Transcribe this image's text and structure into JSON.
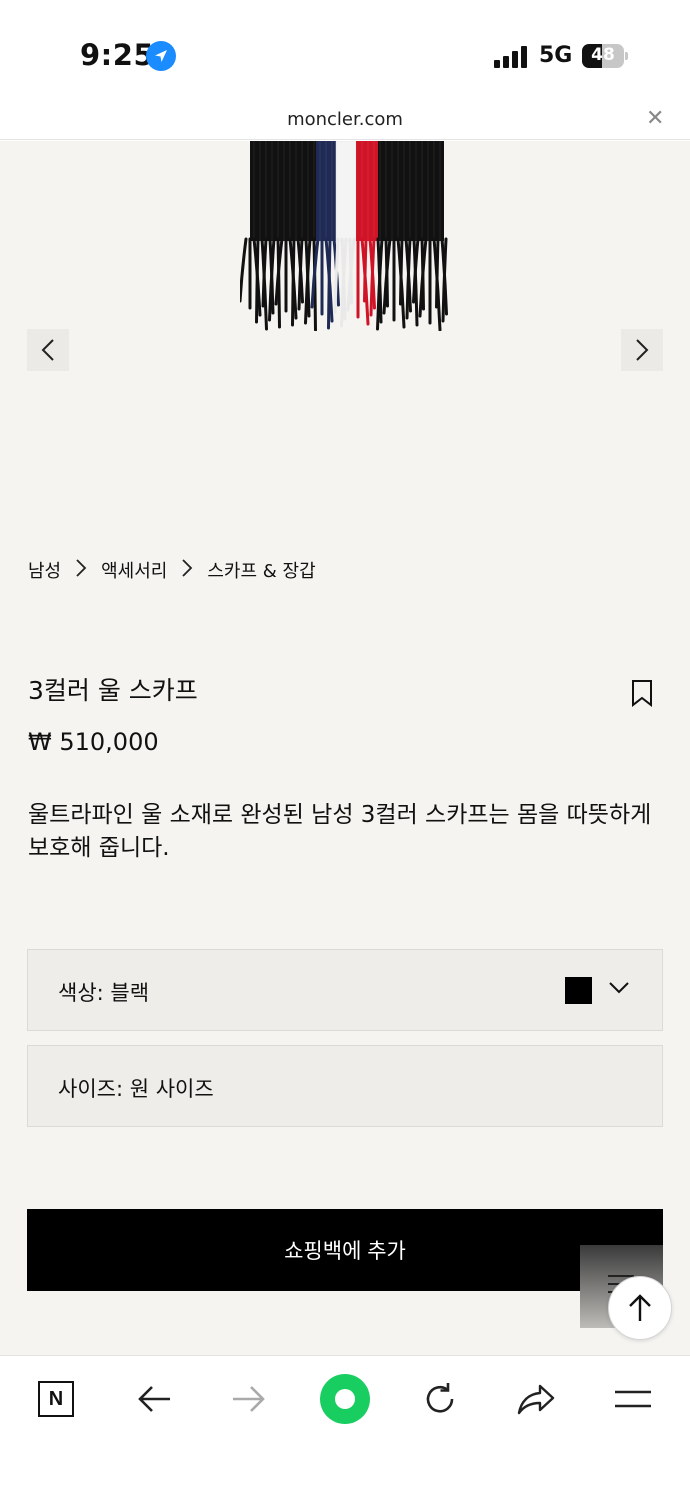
{
  "status_bar": {
    "time": "9:25",
    "network": "5G",
    "battery": "48",
    "battery_level": 0.48
  },
  "address_bar": {
    "domain": "moncler.com"
  },
  "carousel": {
    "image_colors": [
      "#111111",
      "#1f2a55",
      "#f4f4f4",
      "#d01427"
    ]
  },
  "breadcrumb": {
    "items": [
      "남성",
      "액세서리",
      "스카프 & 장갑"
    ]
  },
  "product": {
    "title": "3컬러 울 스카프",
    "price": "₩ 510,000",
    "description": "울트라파인 울 소재로 완성된 남성 3컬러 스카프는 몸을 따뜻하게 보호해 줍니다."
  },
  "options": {
    "color_label": "색상: 블랙",
    "color_swatch": "#000000",
    "size_label": "사이즈: 원 사이즈"
  },
  "actions": {
    "add_to_bag": "쇼핑백에 추가"
  },
  "toolbar": {
    "n_label": "N",
    "home_color": "#19ce60"
  }
}
